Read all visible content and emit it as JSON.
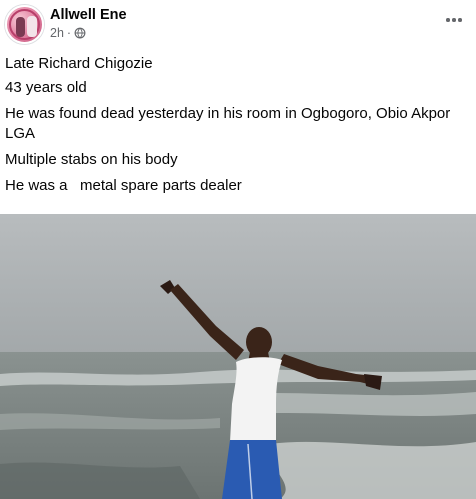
{
  "post": {
    "author": "Allwell Ene",
    "timestamp": "2h",
    "separator": "·",
    "audience_icon": "globe-icon",
    "more_icon": "more-horizontal-icon",
    "text_lines": [
      "Late Richard Chigozie",
      "43 years old",
      "He was found dead yesterday in his room in Ogbogoro, Obio Akpor LGA",
      "Multiple stabs on his body",
      "He was a   metal spare parts dealer"
    ]
  },
  "colors": {
    "text_primary": "#050505",
    "text_secondary": "#65676b",
    "sky": "#a9aeb0",
    "sea": "#7d8685",
    "shorts": "#2a5bb2",
    "singlet": "#f2f2f2"
  }
}
